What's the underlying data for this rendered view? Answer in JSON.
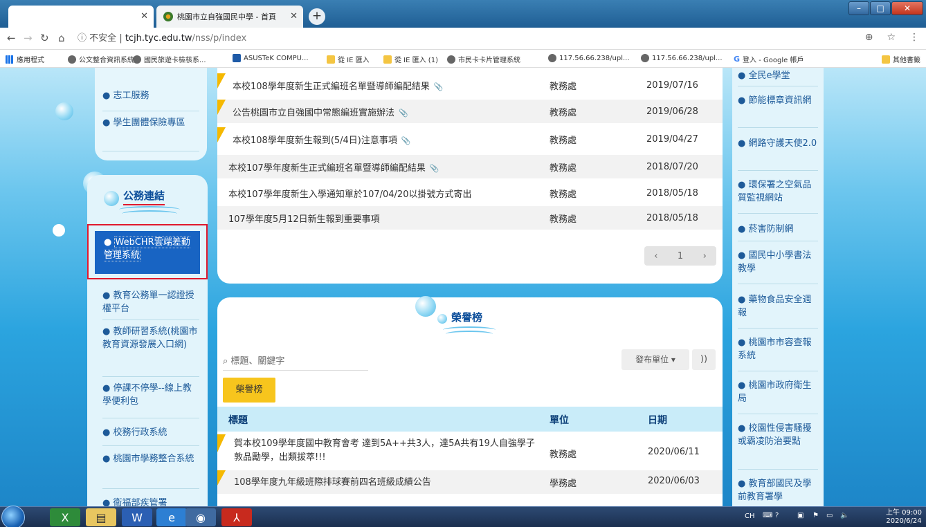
{
  "browser": {
    "tab1_title": "",
    "tab2_title": "桃園市立自強國民中學 - 首頁",
    "url_security": "不安全",
    "url_host": "tcjh.tyc.edu.tw",
    "url_path": "/nss/p/index",
    "bookmarks": [
      "應用程式",
      "公文整合資訊系統",
      "國民旅遊卡檢核系...",
      "ASUSTeK COMPU...",
      "從 IE 匯入",
      "從 IE 匯入 (1)",
      "市民卡卡片管理系統",
      "117.56.66.238/upl...",
      "117.56.66.238/upl...",
      "登入 - Google 帳戶",
      "其他書籤"
    ]
  },
  "left_top": {
    "items": [
      "志工服務",
      "學生團體保險專區"
    ]
  },
  "official_links": {
    "title": "公務連結",
    "highlighted": "WebCHR雲端差勤管理系統",
    "items": [
      "教育公務單一認證授權平台",
      "教師研習系統(桃園市教育資源發展入口網)",
      "停課不停學--線上教學便利包",
      "校務行政系統",
      "桃園市學務整合系統",
      "衛福部疾管署"
    ]
  },
  "news": {
    "rows": [
      {
        "title": "本校108學年度新生正式編班名單暨導師編配結果",
        "unit": "教務處",
        "date": "2019/07/16"
      },
      {
        "title": "公告桃園市立自強國中常態編班實施辦法",
        "unit": "教務處",
        "date": "2019/06/28"
      },
      {
        "title": "本校108學年度新生報到(5/4日)注意事項",
        "unit": "教務處",
        "date": "2019/04/27"
      },
      {
        "title": "本校107學年度新生正式編班名單暨導師編配結果",
        "unit": "教務處",
        "date": "2018/07/20"
      },
      {
        "title": "本校107學年度新生入學通知單於107/04/20以掛號方式寄出",
        "unit": "教務處",
        "date": "2018/05/18"
      },
      {
        "title": "107學年度5月12日新生報到重要事項",
        "unit": "教務處",
        "date": "2018/05/18"
      }
    ],
    "page": "1"
  },
  "honor": {
    "title": "榮譽榜",
    "search_placeholder": "標題、關鍵字",
    "publisher_label": "發布單位",
    "tab_label": "榮譽榜",
    "col_title": "標題",
    "col_unit": "單位",
    "col_date": "日期",
    "rows": [
      {
        "title": "賀本校109學年度國中教育會考 達到5A++共3人，達5A共有19人自強學子敦品勵學，出類拔萃!!!",
        "unit": "教務處",
        "date": "2020/06/11"
      },
      {
        "title": "108學年度九年級班際排球賽前四名班級成績公告",
        "unit": "學務處",
        "date": "2020/06/03"
      }
    ]
  },
  "right_links": [
    "全民e學堂",
    "節能標章資訊網",
    "網路守護天使2.0",
    "環保署之空氣品質監視網站",
    "菸害防制網",
    "國民中小學書法教學",
    "藥物食品安全週報",
    "桃園市市容查報系統",
    "桃園市政府衛生局",
    "校園性侵害騷擾或霸凌防治要點",
    "教育部國民及學前教育署學"
  ],
  "taskbar": {
    "time": "上午 09:00",
    "date": "2020/6/24",
    "ime": "CH"
  }
}
